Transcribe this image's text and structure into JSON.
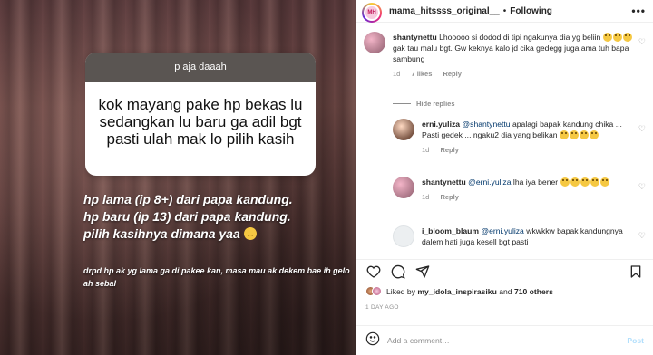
{
  "story": {
    "question_header": "p aja daaah",
    "question_text": "kok mayang pake hp bekas lu sedangkan lu baru ga adil bgt pasti ulah mak lo pilih kasih",
    "overlay_line1": "hp lama (ip 8+) dari papa kandung.",
    "overlay_line2": "hp baru (ip 13) dari papa kandung.",
    "overlay_line3": "pilih kasihnya dimana yaa",
    "overlay_small": "drpd hp ak yg lama ga di pakee kan, masa mau ak dekem bae ih gelo ah sebal"
  },
  "header": {
    "username": "mama_hitssss_original__",
    "dot": "•",
    "follow_label": "Following",
    "more": "•••",
    "avatar_text": "MH"
  },
  "comments": [
    {
      "user": "shantynettu",
      "text": "Lhooooo si dodod di tipi ngakunya dia yg beliin",
      "text2": "gak tau malu bgt. Gw keknya kalo jd cika gedegg juga ama tuh bapa sambung",
      "time": "1d",
      "likes": "7 likes",
      "reply": "Reply"
    },
    {
      "user": "erni.yuliza",
      "mention": "@shantynettu",
      "text": "apalagi bapak kandung chika ... Pasti gedek ... ngaku2 dia yang belikan",
      "time": "1d",
      "reply": "Reply"
    },
    {
      "user": "shantynettu",
      "mention": "@erni.yuliza",
      "text": "lha iya bener",
      "time": "1d",
      "reply": "Reply"
    },
    {
      "user": "i_bloom_blaum",
      "mention": "@erni.yuliza",
      "text": "wkwkkw bapak kandungnya dalem hati juga kesell bgt pasti"
    }
  ],
  "hide_replies": "Hide replies",
  "likes_line": {
    "prefix": "Liked by",
    "user": "my_idola_inspirasiku",
    "and": "and",
    "others": "710 others"
  },
  "timestamp": "1 DAY AGO",
  "composer": {
    "placeholder": "Add a comment…",
    "post_label": "Post"
  },
  "icons": [
    "heart-icon",
    "comment-icon",
    "share-icon",
    "bookmark-icon",
    "smile-icon",
    "more-icon"
  ],
  "colors": {
    "link": "#00376b",
    "muted": "#8e8e8e",
    "post_disabled": "#b2dffc"
  }
}
